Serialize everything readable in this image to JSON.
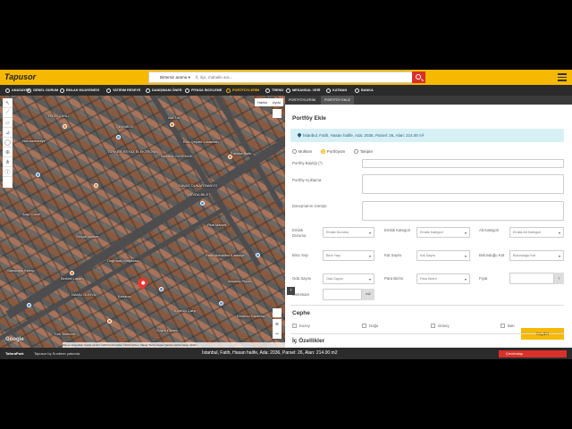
{
  "header": {
    "logo": "Tapusor",
    "search_select": "Birtemiz arama ▾",
    "search_placeholder": "İl, ilçe, mahalle ara..."
  },
  "nav": {
    "items": [
      {
        "label": "ANASAYFA",
        "icon": "home-icon"
      },
      {
        "label": "GENEL DURUM",
        "icon": "pin-icon"
      },
      {
        "label": "EMLAK MUAYENESİ",
        "icon": "check-icon"
      },
      {
        "label": "YATIRIM RESEYE",
        "icon": "chart-icon"
      },
      {
        "label": "DANIŞMANI ÖNER",
        "icon": "user-icon"
      },
      {
        "label": "PİYASA İNCELEME",
        "icon": "bar-icon"
      },
      {
        "label": "PORTFÖYLERİM",
        "icon": "briefcase-icon",
        "active": true
      },
      {
        "label": "TREND",
        "icon": "trend-icon"
      },
      {
        "label": "MEKANSAL VERİ",
        "icon": "map-icon"
      },
      {
        "label": "KATMAN",
        "icon": "layers-icon"
      },
      {
        "label": "BANKA",
        "icon": "bank-icon"
      }
    ]
  },
  "map": {
    "type_buttons": [
      "Harita",
      "Uydu"
    ],
    "labels": [
      "TERZİ CANLI",
      "ÇEKMECE",
      "Akil Tat",
      "Eski Çeşme Lokantası",
      "TÜRKER REYAZ ELEKTRONİK",
      "NAMAN GÜVENLİK",
      "SAVAŞ DUNAR BANYO",
      "SEVDA BİLET",
      "Nuruosmaniye",
      "Fabrika Butik",
      "Pilat Market",
      "Saraçoğlu Kebap",
      "Berketi Lokum",
      "Fatih Mahallesi Kırtasiye",
      "NAMLI DÜNYA",
      "Doğruçay Mağazası",
      "Türk Telekom",
      "Kebabçı",
      "Özgür Ekmek",
      "Aksaray Plaza",
      "Kenteco Gazetesi",
      "Selçuk Market",
      "Arap Camii",
      "Köprülü Çarşı"
    ],
    "google": "Google",
    "attribution": "Klavye kısayolları  Harita verileri ©2024 Görüntüler ©2024 Airbus, Maxar Technologies  Şartlar  Harita hatası bildirin"
  },
  "panel": {
    "tabs": [
      "PORTFÖYLERİM",
      "PORTFÖY EKLE"
    ],
    "title": "Portföy Ekle",
    "address": "İstanbul, Fatih, Hasan halife, Ada: 2036, Parsel: 26, Alan: 214.00 m²",
    "radios": [
      {
        "label": "Mülküm",
        "checked": false
      },
      {
        "label": "Portföyüm",
        "checked": true
      },
      {
        "label": "Takipte",
        "checked": false
      }
    ],
    "fields": {
      "baslik": "Portföy Başlığı (*)",
      "aciklama": "Portföy Açıklama",
      "gorus": "Danışmanın Görüşü"
    },
    "grid": {
      "emlak_durumu": {
        "label": "Emlak Durumu",
        "value": "Emlak Durumu"
      },
      "emlak_kategori": {
        "label": "Emlak Kategori",
        "value": "Emlak Kategori"
      },
      "alt_kategori": {
        "label": "Alt Kategori",
        "value": "Emlak Alt Kategori"
      },
      "bina_yasi": {
        "label": "Bina Yaşı",
        "value": "Bina Yaşı"
      },
      "kat_sayisi": {
        "label": "Kat Sayısı",
        "value": "Kat Sayısı"
      },
      "bulundugu_kat": {
        "label": "Bulunduğu Kat",
        "value": "Bulunduğu Kat"
      },
      "oda_sayisi": {
        "label": "Oda Sayısı",
        "value": "Oda Sayısı"
      },
      "para_birimi": {
        "label": "Para Birimi",
        "value": "Para Birimi"
      },
      "fiyat": {
        "label": "Fiyat",
        "value": "?"
      },
      "metrekare": {
        "label": "Metrekare",
        "unit": "m2"
      }
    },
    "cephe": {
      "title": "Cephe",
      "options": [
        "Kuzey",
        "Doğu",
        "Güney",
        "Batı"
      ]
    },
    "ic_ozellikler_title": "İç Özellikler",
    "save_label": "Kaydet"
  },
  "footer": {
    "brand": "TaforaPark",
    "powered": "Tapusor by Sunbeer yakında",
    "address": "İstanbul, Fatih, Hasan halife, Ada: 2036, Parsel: 26, Alan: 214.00 m2",
    "status": "Çevrimdışı"
  },
  "colors": {
    "accent": "#f6b800",
    "dark": "#2b2b2b",
    "danger": "#d9302a",
    "info_bg": "#d7f0f5"
  }
}
